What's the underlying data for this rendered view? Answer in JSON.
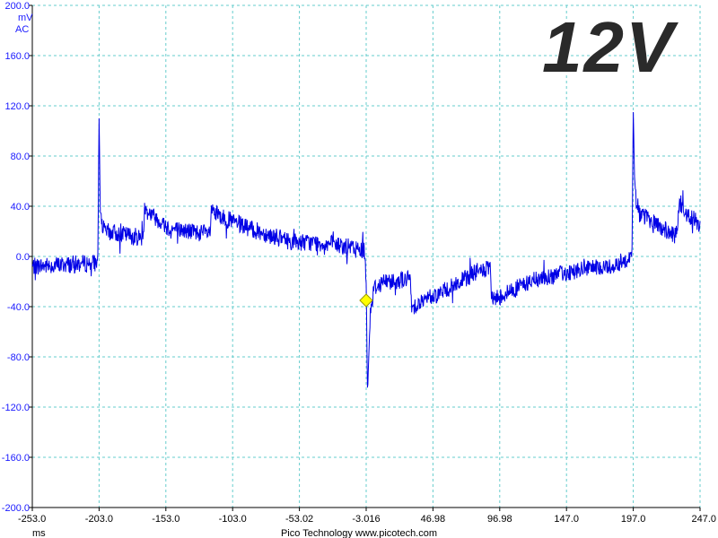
{
  "badge": "12V",
  "credit": "Pico Technology  www.picotech.com",
  "colors": {
    "trace": "#0000e6",
    "grid": "#66cccc",
    "trigger": "#ffff00",
    "axis": "#000000",
    "y_labels": "#1a1aff"
  },
  "chart_data": {
    "type": "line",
    "y_units": [
      "mV",
      "AC"
    ],
    "xlabel": "ms",
    "ylim": [
      -200,
      200
    ],
    "xlim": [
      -253.0,
      247.0
    ],
    "y_ticks": [
      "200.0",
      "160.0",
      "120.0",
      "80.0",
      "40.0",
      "0.0",
      "-40.0",
      "-80.0",
      "-120.0",
      "-160.0",
      "-200.0"
    ],
    "x_ticks": [
      "-253.0",
      "-203.0",
      "-153.0",
      "-103.0",
      "-53.02",
      "-3.016",
      "46.98",
      "96.98",
      "147.0",
      "197.0",
      "247.0"
    ],
    "grid": true,
    "trigger": {
      "x": -3.016,
      "y": -35
    },
    "series": [
      {
        "x": [
          -253,
          -204,
          -203,
          -202,
          -199,
          -170,
          -169,
          -150,
          -120,
          -119,
          -90,
          -60,
          -30,
          -4,
          -3.016,
          -2,
          0,
          3,
          10,
          30,
          31,
          60,
          80,
          90,
          91,
          120,
          150,
          180,
          196,
          197,
          198,
          200,
          230,
          231,
          247
        ],
        "y": [
          -8,
          -5,
          110,
          30,
          20,
          15,
          38,
          22,
          18,
          35,
          22,
          12,
          10,
          5,
          -20,
          -110,
          -45,
          -25,
          -20,
          -18,
          -40,
          -25,
          -12,
          -10,
          -35,
          -20,
          -12,
          -8,
          0,
          115,
          60,
          35,
          15,
          40,
          25
        ]
      }
    ]
  }
}
